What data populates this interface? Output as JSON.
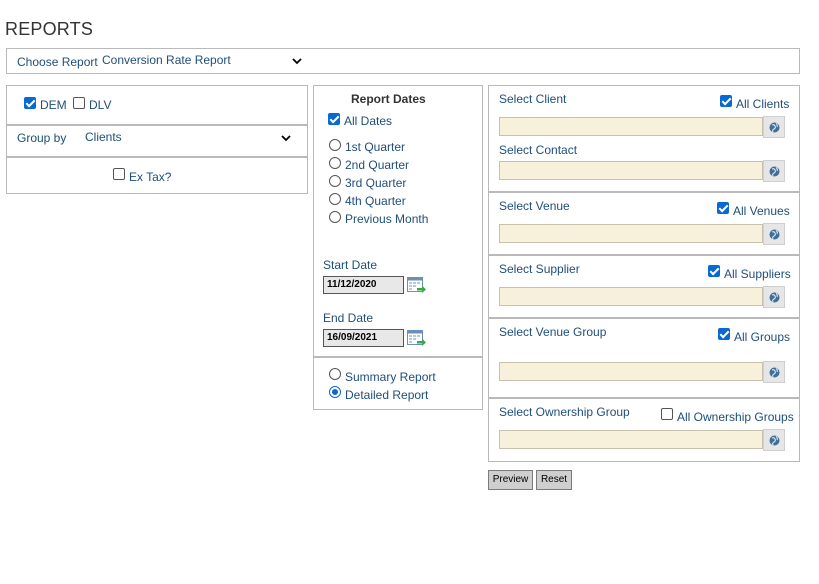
{
  "page": {
    "title": "REPORTS"
  },
  "choose_report": {
    "label": "Choose Report",
    "selected": "Conversion Rate Report"
  },
  "left_panel": {
    "dem": {
      "label": "DEM",
      "checked": true
    },
    "dlv": {
      "label": "DLV",
      "checked": false
    },
    "group_by": {
      "label": "Group by",
      "selected": "Clients"
    },
    "ex_tax": {
      "label": "Ex Tax?",
      "checked": false
    }
  },
  "report_dates": {
    "heading": "Report Dates",
    "all_dates": {
      "label": "All Dates",
      "checked": true
    },
    "options": [
      {
        "label": "1st Quarter"
      },
      {
        "label": "2nd Quarter"
      },
      {
        "label": "3rd Quarter"
      },
      {
        "label": "4th Quarter"
      },
      {
        "label": "Previous Month"
      }
    ],
    "start_date": {
      "label": "Start Date",
      "value": "11/12/2020"
    },
    "end_date": {
      "label": "End Date",
      "value": "16/09/2021"
    }
  },
  "report_type": {
    "summary": {
      "label": "Summary Report",
      "checked": false
    },
    "detailed": {
      "label": "Detailed Report",
      "checked": true
    }
  },
  "filters": {
    "client": {
      "label": "Select Client",
      "all_label": "All Clients",
      "all_checked": true
    },
    "contact": {
      "label": "Select Contact"
    },
    "venue": {
      "label": "Select Venue",
      "all_label": "All Venues",
      "all_checked": true
    },
    "supplier": {
      "label": "Select Supplier",
      "all_label": "All Suppliers",
      "all_checked": true
    },
    "venue_group": {
      "label": "Select Venue Group",
      "all_label": "All Groups",
      "all_checked": true
    },
    "ownership_group": {
      "label": "Select Ownership Group",
      "all_label": "All Ownership Groups",
      "all_checked": false
    }
  },
  "actions": {
    "preview_label": "Preview",
    "reset_label": "Reset"
  },
  "colors": {
    "label_text": "#1f4e79",
    "lookup_field": "#f7f1dc",
    "checkbox_accent": "#0a67d6",
    "border": "#b9b9b9"
  },
  "icons": {
    "lookup": "globe-icon",
    "calendar": "calendar-icon"
  }
}
